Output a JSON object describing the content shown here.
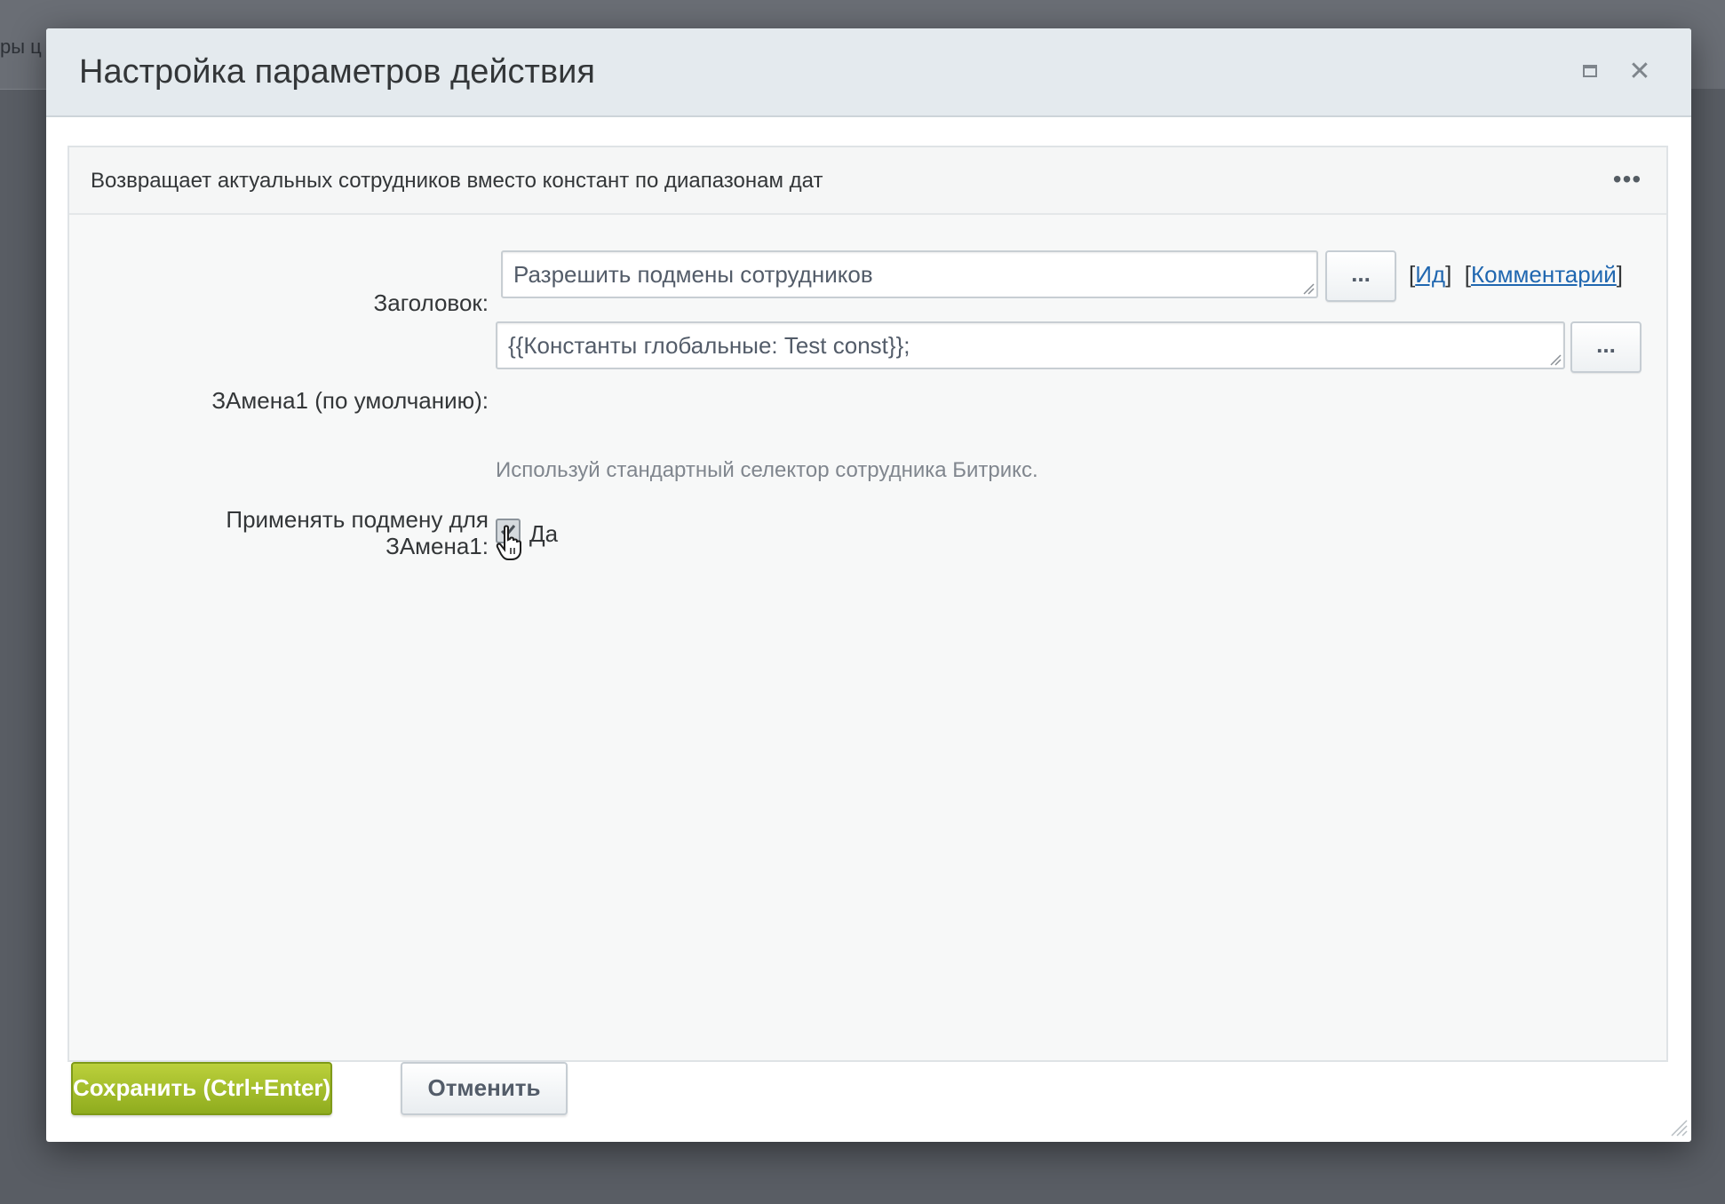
{
  "background": {
    "partial_text": "ры ц"
  },
  "dialog": {
    "title": "Настройка параметров действия",
    "maximize_icon": "maximize-icon",
    "close_icon": "close-icon",
    "close_glyph": "✕"
  },
  "panel": {
    "description": "Возвращает актуальных сотрудников вместо констант по диапазонам дат",
    "more_glyph": "•••"
  },
  "fields": {
    "title": {
      "label": "Заголовок:",
      "value": "Разрешить подмены сотрудников",
      "dots_label": "...",
      "links_open1": "[",
      "link_id": "Ид",
      "links_close1": "]",
      "links_open2": "[",
      "link_comment": "Комментарий",
      "links_close2": "]"
    },
    "replacement": {
      "label": "ЗАмена1 (по умолчанию):",
      "value": "{{Константы глобальные: Test const}};",
      "dots_label": "...",
      "hint": "Используй стандартный селектор сотрудника Битрикс."
    },
    "apply": {
      "label_line1": "Применять подмену для",
      "label_line2": "ЗАмена1:",
      "checkbox_label": "Да",
      "checked": true
    }
  },
  "footer": {
    "save_label": "Сохранить (Ctrl+Enter)",
    "cancel_label": "Отменить"
  },
  "colors": {
    "accent_green": "#9bb827",
    "link_blue": "#2067b0",
    "header_bg": "#e4eaee"
  }
}
